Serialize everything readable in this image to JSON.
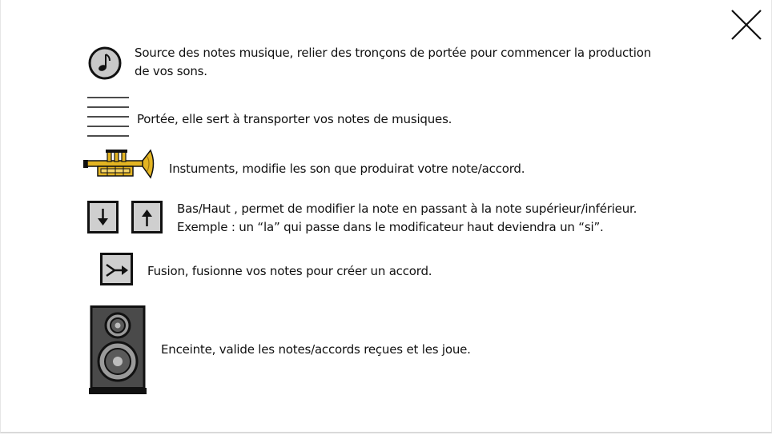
{
  "help": {
    "items": [
      {
        "icon": "music-note-source-icon",
        "line1": "Source des notes musique, relier des tronçons de portée pour commencer la production",
        "line2": "de vos sons."
      },
      {
        "icon": "staff-lines-icon",
        "line1": "Portée, elle sert à transporter vos notes de musiques."
      },
      {
        "icon": "trumpet-icon",
        "line1": "Instuments, modifie les son que produirat votre note/accord."
      },
      {
        "icon": "arrow-down-up-icon",
        "line1": "Bas/Haut , permet de modifier la note en passant à la note supérieur/inférieur.",
        "line2": "Exemple : un “la” qui passe dans le modificateur haut deviendra un “si”."
      },
      {
        "icon": "fusion-merge-icon",
        "line1": "Fusion, fusionne vos notes pour créer un accord."
      },
      {
        "icon": "speaker-icon",
        "line1": "Enceinte, valide les notes/accords reçues et les joue."
      }
    ]
  }
}
